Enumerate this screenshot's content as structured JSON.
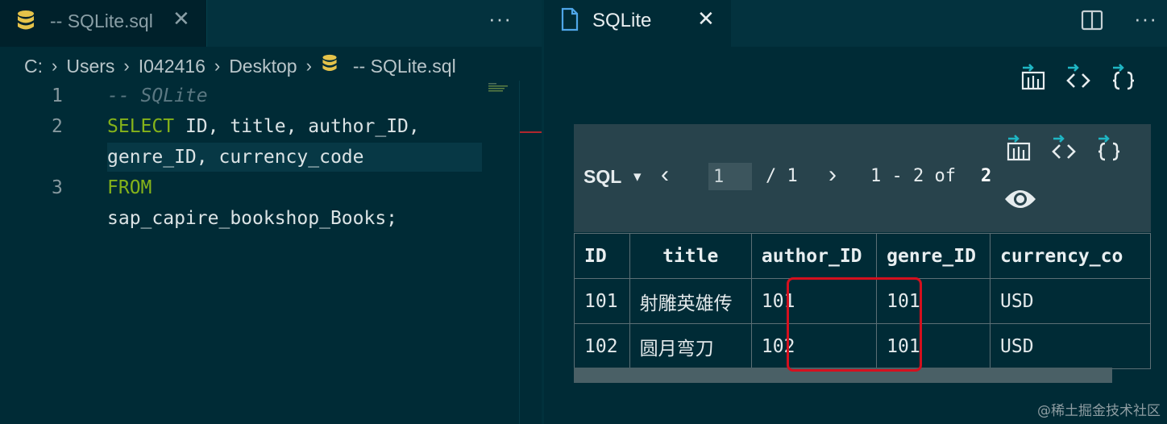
{
  "left_editor": {
    "tab": {
      "label": "-- SQLite.sql",
      "close": "✕"
    },
    "more": "···",
    "breadcrumb": [
      "C:",
      "Users",
      "I042416",
      "Desktop",
      "-- SQLite.sql"
    ],
    "line_numbers": [
      "1",
      "2",
      "3"
    ],
    "code": {
      "comment": "-- SQLite",
      "select_kw": "SELECT",
      "select_rest": " ID, title, author_ID,",
      "select_wrap": "genre_ID, currency_code",
      "from_kw": "FROM",
      "from_wrap": "sap_capire_bookshop_Books;"
    }
  },
  "right_editor": {
    "tab": {
      "label": "SQLite",
      "close": "✕"
    },
    "more": "···",
    "results": {
      "sql_label": "SQL",
      "sql_caret": "▾",
      "prev": "‹",
      "page_value": "1",
      "page_total": "/ 1",
      "next": "›",
      "row_range": "1 - 2 of",
      "row_count": "2",
      "columns": [
        "ID",
        "title",
        "author_ID",
        "genre_ID",
        "currency_co"
      ],
      "rows": [
        [
          "101",
          "射雕英雄传",
          "101",
          "101",
          "USD"
        ],
        [
          "102",
          "圆月弯刀",
          "102",
          "101",
          "USD"
        ]
      ]
    }
  },
  "icons": {
    "db": "database-icon",
    "file": "file-icon",
    "split": "split-editor-icon",
    "export_csv": "export-csv-icon",
    "export_html": "export-html-icon",
    "export_json": "export-json-icon",
    "eye": "eye-icon"
  },
  "colors": {
    "background": "#002b36",
    "keyword": "#85b31a",
    "comment": "#5b7882",
    "accent_teal": "#1fb6c4",
    "db_icon": "#e5c34a",
    "highlight": "#d4101e"
  },
  "watermark": "@稀土掘金技术社区"
}
